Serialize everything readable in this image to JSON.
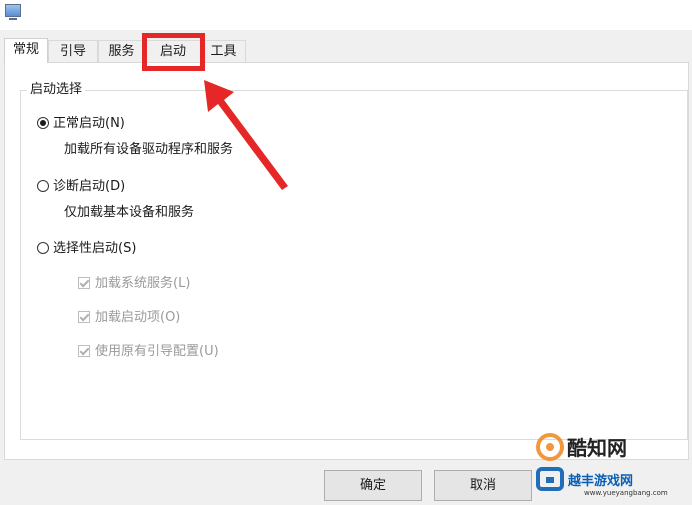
{
  "tabs": [
    {
      "label": "常规"
    },
    {
      "label": "引导"
    },
    {
      "label": "服务"
    },
    {
      "label": "启动"
    },
    {
      "label": "工具"
    }
  ],
  "selected_tab": "常规",
  "group": {
    "legend": "启动选择",
    "options": [
      {
        "label": "正常启动(N)",
        "description": "加载所有设备驱动程序和服务",
        "checked": true
      },
      {
        "label": "诊断启动(D)",
        "description": "仅加载基本设备和服务",
        "checked": false
      },
      {
        "label": "选择性启动(S)",
        "checked": false
      }
    ],
    "selective_items": [
      {
        "label": "加载系统服务(L)",
        "checked": true,
        "disabled": true
      },
      {
        "label": "加载启动项(O)",
        "checked": true,
        "disabled": true
      },
      {
        "label": "使用原有引导配置(U)",
        "checked": true,
        "disabled": true
      }
    ]
  },
  "buttons": {
    "ok": "确定",
    "cancel": "取消"
  },
  "annotation": {
    "color": "#e52727"
  },
  "watermark": {
    "title": "酷知网",
    "subtitle": "越丰游戏网",
    "url": "www.yueyangbang.com"
  }
}
